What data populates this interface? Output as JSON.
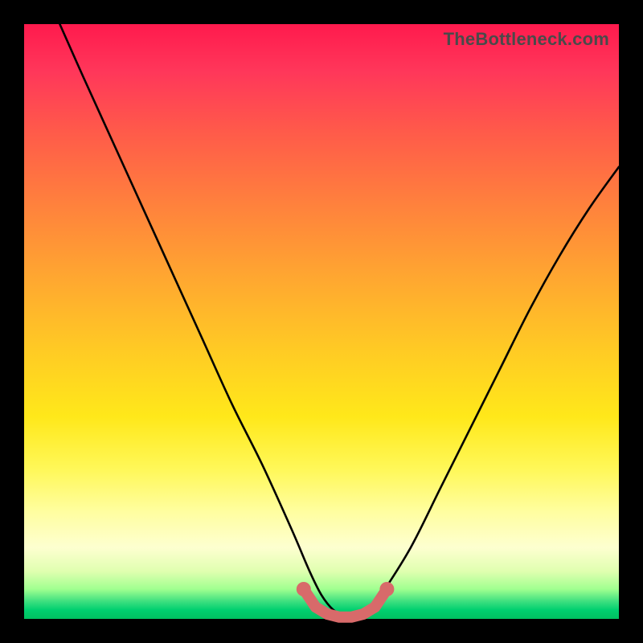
{
  "watermark": "TheBottleneck.com",
  "chart_data": {
    "type": "line",
    "title": "",
    "xlabel": "",
    "ylabel": "",
    "xlim": [
      0,
      100
    ],
    "ylim": [
      0,
      100
    ],
    "grid": false,
    "legend": false,
    "background_gradient": [
      "#ff1a4d",
      "#ff803d",
      "#ffe81a",
      "#00c060"
    ],
    "series": [
      {
        "name": "bottleneck-curve",
        "color": "#000000",
        "x": [
          6,
          10,
          15,
          20,
          25,
          30,
          35,
          40,
          45,
          48,
          50,
          52,
          54,
          55,
          56,
          58,
          60,
          65,
          70,
          75,
          80,
          85,
          90,
          95,
          100
        ],
        "y": [
          100,
          91,
          80,
          69,
          58,
          47,
          36,
          26,
          15,
          8,
          4,
          1.5,
          0.4,
          0.2,
          0.4,
          1.5,
          4,
          12,
          22,
          32,
          42,
          52,
          61,
          69,
          76
        ]
      },
      {
        "name": "optimal-zone-markers",
        "color": "#d86a6a",
        "style": "points",
        "x": [
          47,
          49,
          51,
          53,
          55,
          57,
          59,
          61
        ],
        "y": [
          5,
          2,
          0.8,
          0.3,
          0.3,
          0.8,
          2,
          5
        ]
      }
    ]
  }
}
